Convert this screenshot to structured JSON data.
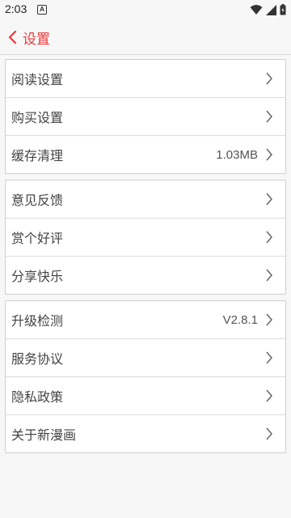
{
  "status_bar": {
    "time": "2:03",
    "notification_glyph": "A"
  },
  "header": {
    "title": "设置",
    "accent": "#e33b3b"
  },
  "groups": [
    {
      "items": [
        {
          "label": "阅读设置",
          "value": ""
        },
        {
          "label": "购买设置",
          "value": ""
        },
        {
          "label": "缓存清理",
          "value": "1.03MB"
        }
      ]
    },
    {
      "items": [
        {
          "label": "意见反馈",
          "value": ""
        },
        {
          "label": "赏个好评",
          "value": ""
        },
        {
          "label": "分享快乐",
          "value": ""
        }
      ]
    },
    {
      "items": [
        {
          "label": "升级检测",
          "value": "V2.8.1"
        },
        {
          "label": "服务协议",
          "value": ""
        },
        {
          "label": "隐私政策",
          "value": ""
        },
        {
          "label": "关于新漫画",
          "value": ""
        }
      ]
    }
  ]
}
